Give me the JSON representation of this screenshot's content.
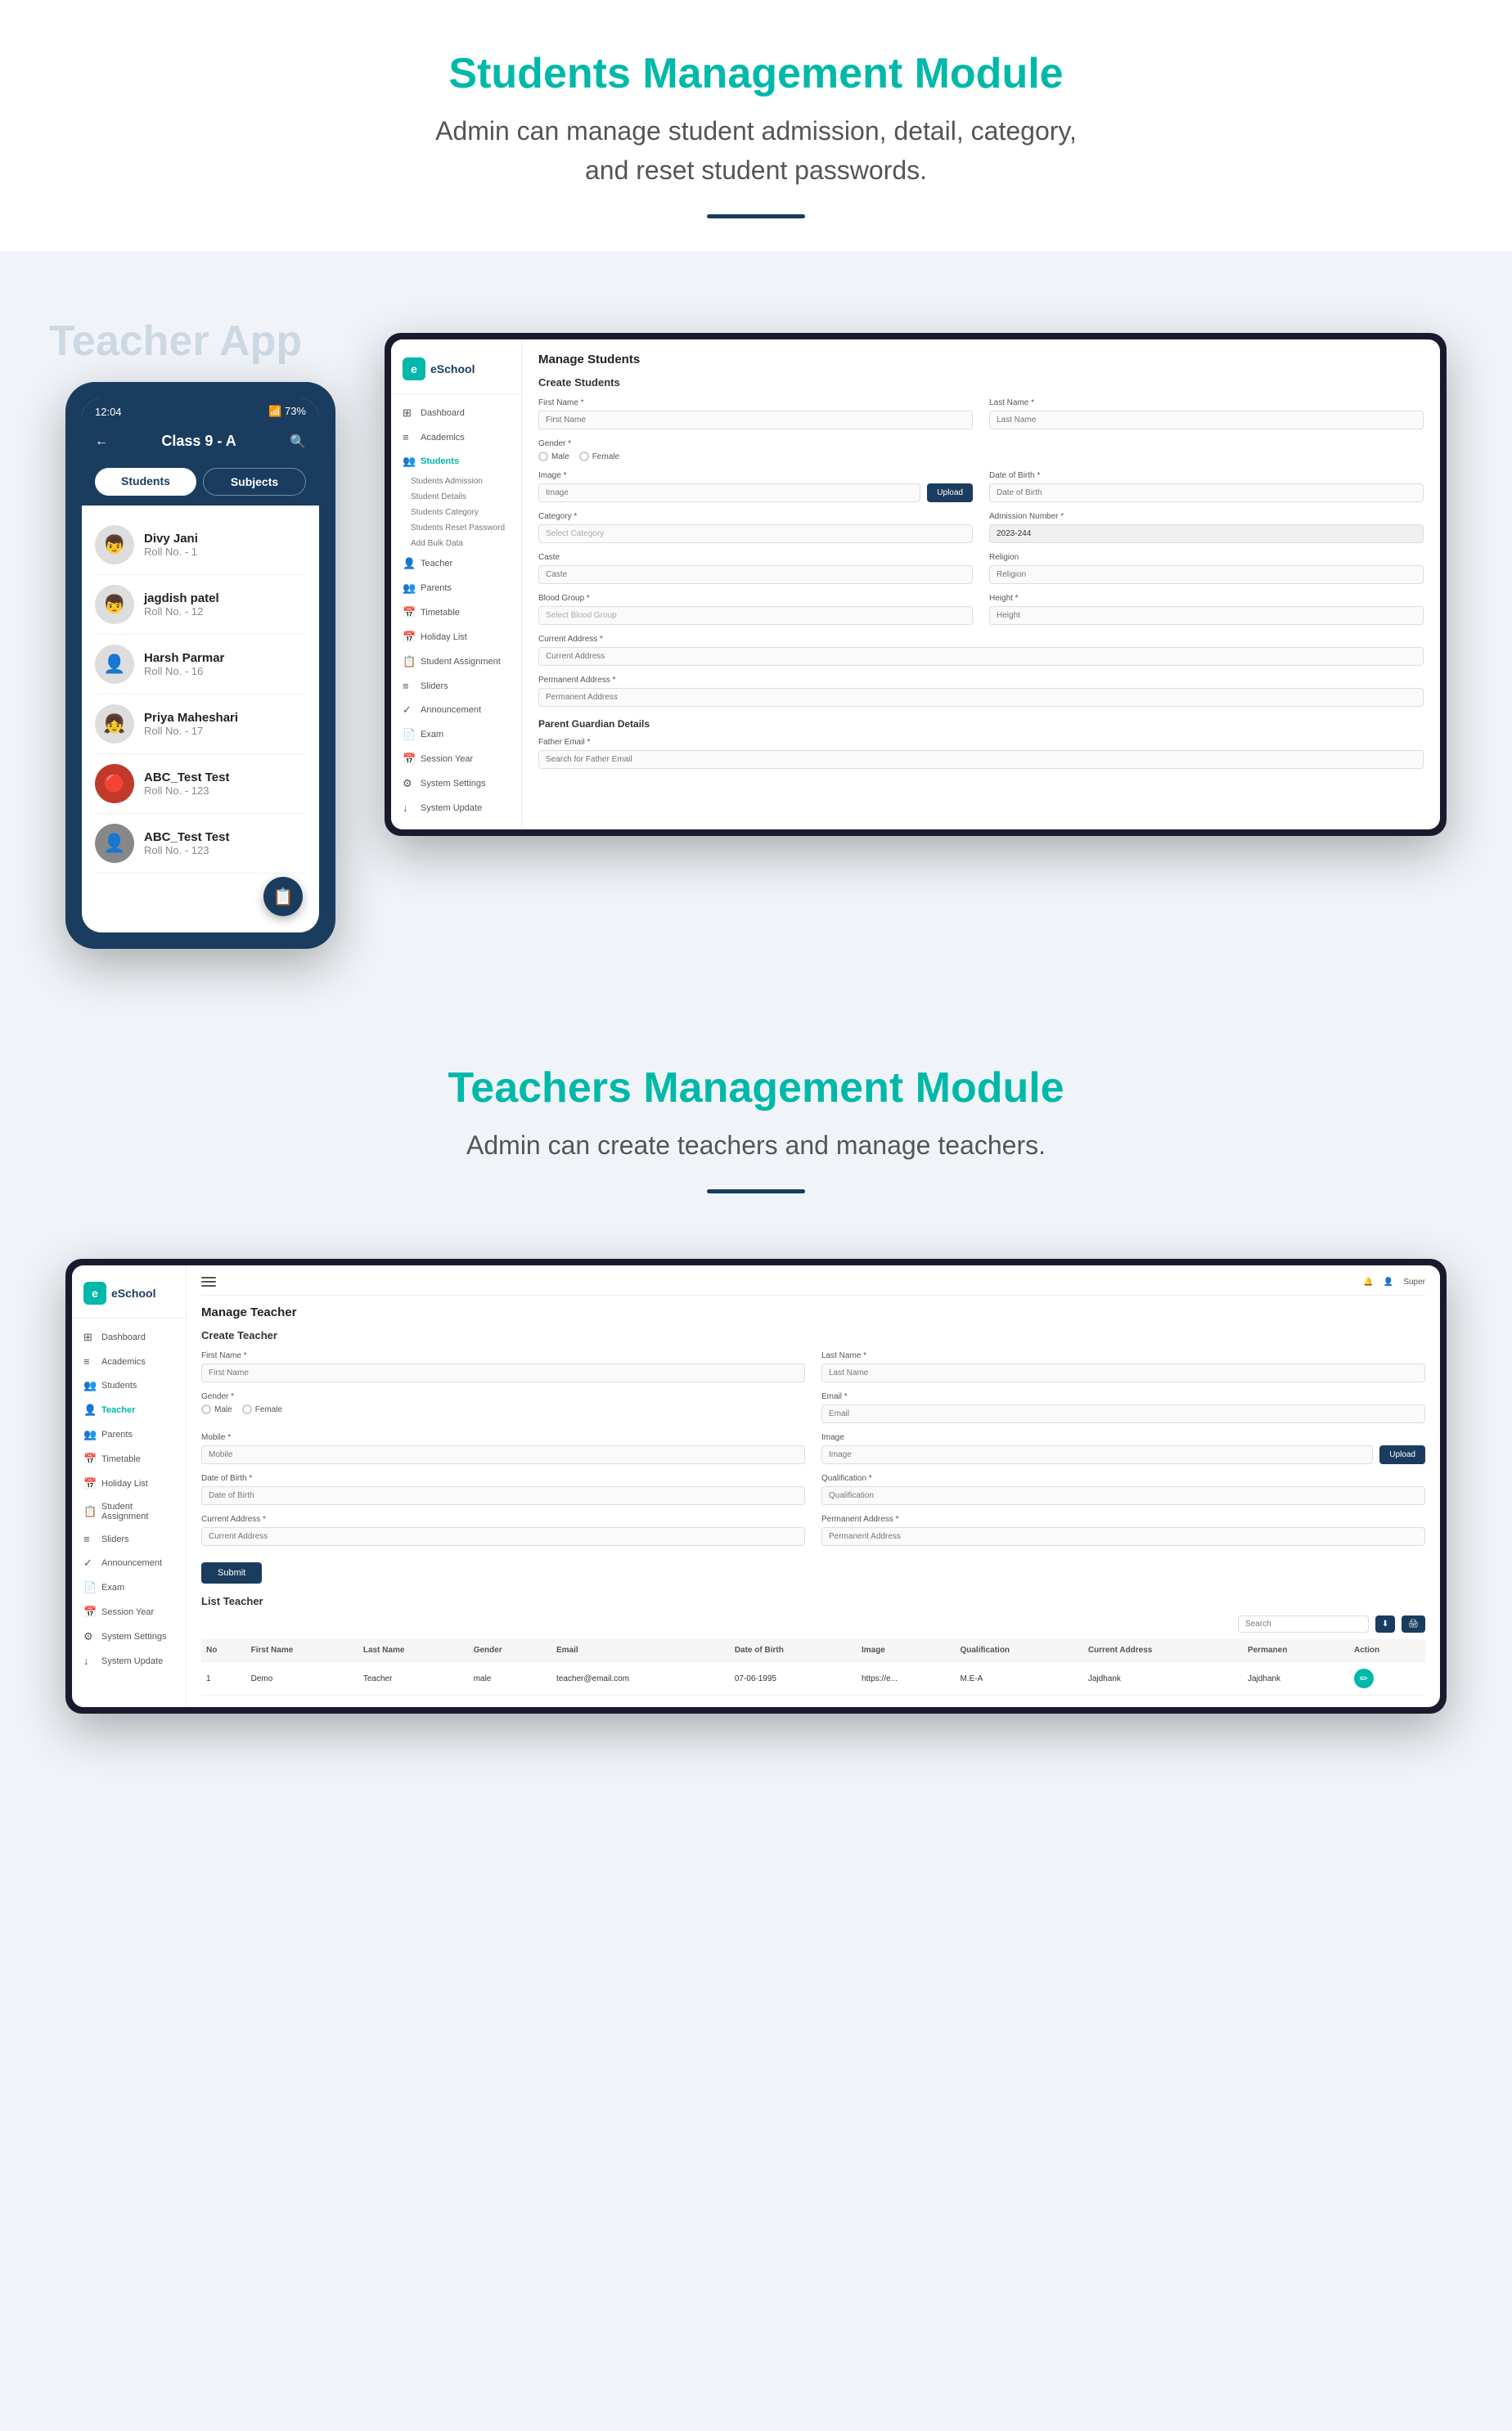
{
  "section1": {
    "title": "Students Management Module",
    "description": "Admin can manage student admission, detail, category,\nand reset student passwords.",
    "divider_color": "#1a3c5e"
  },
  "teacherApp": {
    "label": "Teacher App",
    "phone": {
      "status_time": "12:04",
      "battery": "73%",
      "nav_title": "Class 9 - A",
      "tab_students": "Students",
      "tab_subjects": "Subjects",
      "students": [
        {
          "name": "Divy Jani",
          "roll": "Roll No. - 1",
          "avatar": "👦"
        },
        {
          "name": "jagdish patel",
          "roll": "Roll No. - 12",
          "avatar": "👦"
        },
        {
          "name": "Harsh Parmar",
          "roll": "Roll No. - 16",
          "avatar": "👤"
        },
        {
          "name": "Priya Maheshari",
          "roll": "Roll No. - 17",
          "avatar": "👧"
        },
        {
          "name": "ABC_Test Test",
          "roll": "Roll No. - 123",
          "avatar": "🔴"
        },
        {
          "name": "ABC_Test Test",
          "roll": "Roll No. - 123",
          "avatar": "👤"
        }
      ]
    }
  },
  "adminPanel1": {
    "logo": "eSchool",
    "page_title": "Manage Students",
    "section_title": "Create Students",
    "sidebar": [
      {
        "label": "Dashboard",
        "icon": "⊞",
        "active": false
      },
      {
        "label": "Academics",
        "icon": "≡",
        "active": false
      },
      {
        "label": "Students",
        "icon": "👥",
        "active": true
      },
      {
        "label": "Students Admission",
        "sub": true
      },
      {
        "label": "Student Details",
        "sub": true
      },
      {
        "label": "Students Category",
        "sub": true
      },
      {
        "label": "Students Reset Password",
        "sub": true
      },
      {
        "label": "Add Bulk Data",
        "sub": true
      },
      {
        "label": "Teacher",
        "icon": "👤",
        "active": false
      },
      {
        "label": "Parents",
        "icon": "👥",
        "active": false
      },
      {
        "label": "Timetable",
        "icon": "📅",
        "active": false
      },
      {
        "label": "Holiday List",
        "icon": "📅",
        "active": false
      },
      {
        "label": "Student Assignment",
        "icon": "📋",
        "active": false
      },
      {
        "label": "Sliders",
        "icon": "≡",
        "active": false
      },
      {
        "label": "Announcement",
        "icon": "✓",
        "active": false
      },
      {
        "label": "Exam",
        "icon": "📄",
        "active": false
      },
      {
        "label": "Session Year",
        "icon": "📅",
        "active": false
      },
      {
        "label": "System Settings",
        "icon": "⚙",
        "active": false
      },
      {
        "label": "System Update",
        "icon": "↓",
        "active": false
      }
    ],
    "form": {
      "first_name_label": "First Name *",
      "first_name_placeholder": "First Name",
      "last_name_label": "Last Name *",
      "last_name_placeholder": "Last Name",
      "gender_label": "Gender *",
      "gender_male": "Male",
      "gender_female": "Female",
      "image_label": "Image *",
      "image_placeholder": "Image",
      "upload_btn": "Upload",
      "dob_label": "Date of Birth *",
      "dob_placeholder": "Date of Birth",
      "category_label": "Category *",
      "category_placeholder": "Select Category",
      "admission_label": "Admission Number *",
      "admission_value": "2023-244",
      "caste_label": "Caste",
      "caste_placeholder": "Caste",
      "religion_label": "Religion",
      "religion_placeholder": "Religion",
      "blood_group_label": "Blood Group *",
      "blood_group_placeholder": "Select Blood Group",
      "height_label": "Height *",
      "height_placeholder": "Height",
      "current_address_label": "Current Address *",
      "current_address_placeholder": "Current Address",
      "permanent_address_label": "Permanent Address *",
      "permanent_address_placeholder": "Permanent Address",
      "parent_section": "Parent Guardian Details",
      "father_email_label": "Father Email *",
      "father_email_placeholder": "Search for Father Email"
    }
  },
  "section2": {
    "title": "Teachers Management Module",
    "description": "Admin can create teachers and manage teachers.",
    "divider_color": "#1a3c5e"
  },
  "adminPanel2": {
    "logo": "eSchool",
    "header_right": "Super",
    "page_title": "Manage Teacher",
    "section_title": "Create Teacher",
    "sidebar": [
      {
        "label": "Dashboard",
        "icon": "⊞"
      },
      {
        "label": "Academics",
        "icon": "≡"
      },
      {
        "label": "Students",
        "icon": "👥"
      },
      {
        "label": "Teacher",
        "icon": "👤",
        "active": true
      },
      {
        "label": "Parents",
        "icon": "👥"
      },
      {
        "label": "Timetable",
        "icon": "📅"
      },
      {
        "label": "Holiday List",
        "icon": "📅"
      },
      {
        "label": "Student Assignment",
        "icon": "📋"
      },
      {
        "label": "Sliders",
        "icon": "≡"
      },
      {
        "label": "Announcement",
        "icon": "✓"
      },
      {
        "label": "Exam",
        "icon": "📄"
      },
      {
        "label": "Session Year",
        "icon": "📅"
      },
      {
        "label": "System Settings",
        "icon": "⚙"
      },
      {
        "label": "System Update",
        "icon": "↓"
      }
    ],
    "form": {
      "first_name_label": "First Name *",
      "first_name_placeholder": "First Name",
      "last_name_label": "Last Name *",
      "last_name_placeholder": "Last Name",
      "gender_label": "Gender *",
      "gender_male": "Male",
      "gender_female": "Female",
      "email_label": "Email *",
      "email_placeholder": "Email",
      "mobile_label": "Mobile *",
      "mobile_placeholder": "Mobile",
      "image_label": "Image",
      "image_placeholder": "Image",
      "upload_btn": "Upload",
      "dob_label": "Date of Birth *",
      "dob_placeholder": "Date of Birth",
      "qualification_label": "Qualification *",
      "qualification_placeholder": "Qualification",
      "current_address_label": "Current Address *",
      "current_address_placeholder": "Current Address",
      "permanent_address_label": "Permanent Address *",
      "permanent_address_placeholder": "Permanent Address",
      "submit_btn": "Submit"
    },
    "table": {
      "title": "List Teacher",
      "search_placeholder": "Search",
      "columns": [
        "No",
        "First Name",
        "Last Name",
        "Gender",
        "Email",
        "Date of Birth",
        "Image",
        "Qualification",
        "Current Address",
        "Permanen",
        "Action"
      ],
      "rows": [
        {
          "no": "1",
          "first_name": "Demo",
          "last_name": "Teacher",
          "gender": "male",
          "email": "teacher@email.com",
          "dob": "07-06-1995",
          "image": "https://e...",
          "qualification": "M.E-A",
          "current_address": "Jajdhank",
          "permanent": "Jajdhank",
          "action": "edit"
        }
      ]
    }
  }
}
